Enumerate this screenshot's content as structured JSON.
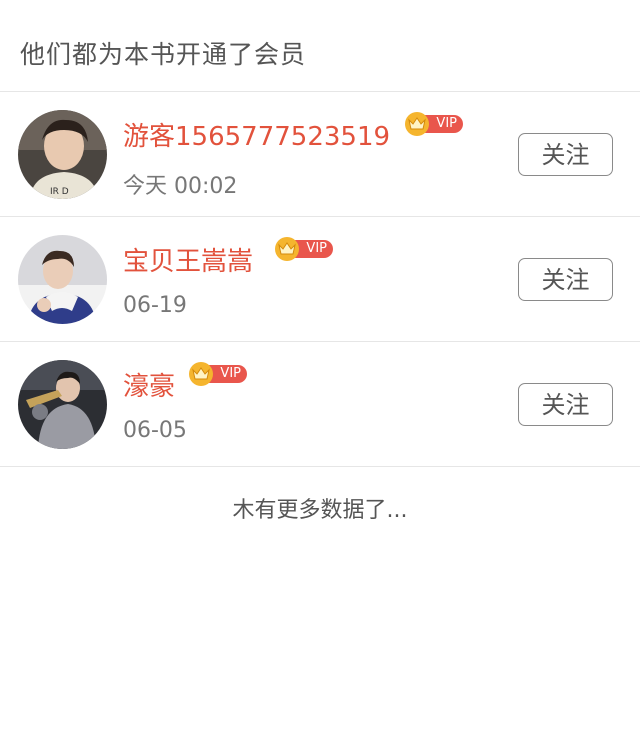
{
  "header": {
    "title": "他们都为本书开通了会员"
  },
  "members": [
    {
      "name": "游客1565777523519",
      "badge": "VIP",
      "date": "今天 00:02",
      "follow_label": "关注"
    },
    {
      "name": "宝贝王嵩嵩",
      "badge": "VIP",
      "date": "06-19",
      "follow_label": "关注"
    },
    {
      "name": "濠豪",
      "badge": "VIP",
      "date": "06-05",
      "follow_label": "关注"
    }
  ],
  "footer": {
    "text": "木有更多数据了..."
  },
  "colors": {
    "name": "#e2523c",
    "vip_pill": "#e9564c",
    "crown": "#f5b52e",
    "divider": "#e6e6e6"
  }
}
